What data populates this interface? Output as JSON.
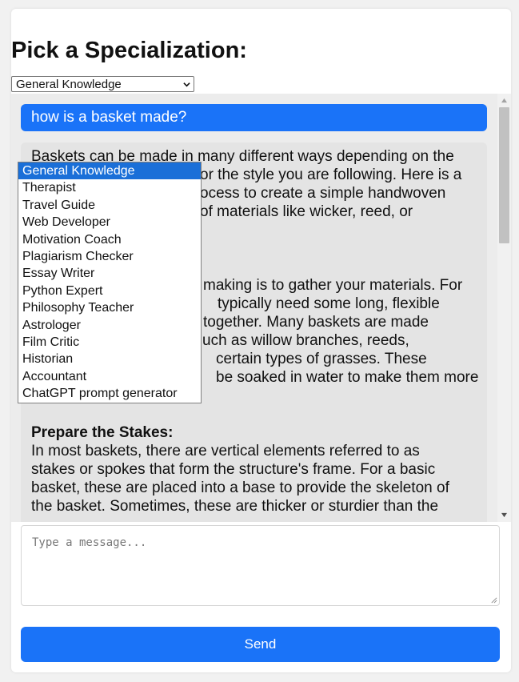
{
  "page": {
    "title": "Pick a Specialization:"
  },
  "specialization": {
    "selected": "General Knowledge",
    "options": [
      "General Knowledge",
      "Therapist",
      "Travel Guide",
      "Web Developer",
      "Motivation Coach",
      "Plagiarism Checker",
      "Essay Writer",
      "Python Expert",
      "Philosophy Teacher",
      "Astrologer",
      "Film Critic",
      "Historian",
      "Accountant",
      "ChatGPT prompt generator"
    ]
  },
  "chat": {
    "user_message": "how is a basket made?",
    "assistant_lines": [
      "Baskets can be made in many different ways depending on the",
      "or the style you are following. Here is a",
      "ocess to create a simple handwoven",
      "of materials like wicker, reed, or",
      "",
      "",
      "",
      "making is to gather your materials. For",
      "typically need some long, flexible",
      "together. Many baskets are made",
      "uch as willow branches, reeds,",
      "certain types of grasses. These",
      "be soaked in water to make them more"
    ],
    "section_heading": "Prepare the Stakes:",
    "section_lines": [
      "In most baskets, there are vertical elements referred to as",
      "stakes or spokes that form the structure's frame. For a basic",
      "basket, these are placed into a base to provide the skeleton of",
      "the basket. Sometimes, these are thicker or sturdier than the"
    ]
  },
  "composer": {
    "placeholder": "Type a message...",
    "send_label": "Send"
  },
  "colors": {
    "accent": "#1a73f8",
    "dropdown_highlight": "#1a6fd8",
    "chat_background": "#ececec"
  }
}
